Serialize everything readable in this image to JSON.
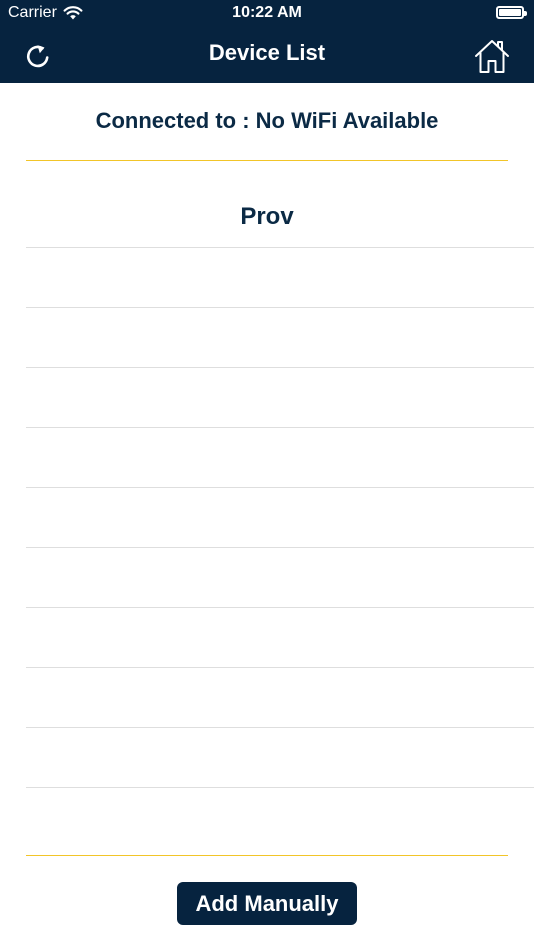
{
  "status_bar": {
    "carrier": "Carrier",
    "time": "10:22 AM",
    "wifi_icon": "wifi-icon",
    "battery_icon": "battery-icon"
  },
  "nav": {
    "title": "Device List",
    "left_icon": "refresh-icon",
    "right_icon": "home-icon"
  },
  "connection": {
    "text": "Connected to : No WiFi Available"
  },
  "section": {
    "title": "Prov"
  },
  "device_rows": [
    "",
    "",
    "",
    "",
    "",
    "",
    "",
    "",
    "",
    ""
  ],
  "footer": {
    "add_button_label": "Add Manually"
  },
  "colors": {
    "header_bg": "#06233f",
    "accent_gold": "#f2c529",
    "text_dark": "#0b2a45",
    "row_divider": "#dedede"
  }
}
